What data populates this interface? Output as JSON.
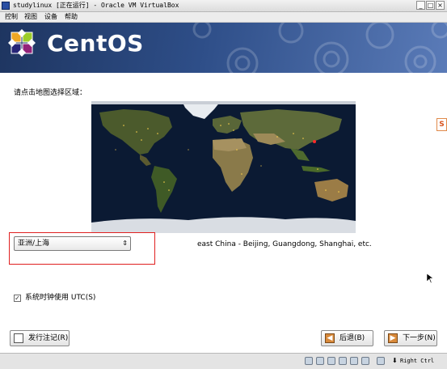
{
  "window": {
    "title": "studylinux [正在运行] - Oracle VM VirtualBox",
    "minimize_glyph": "_",
    "maximize_glyph": "□",
    "close_glyph": "×"
  },
  "menubar": {
    "items": [
      "控制",
      "视图",
      "设备",
      "帮助"
    ]
  },
  "banner": {
    "wordmark": "CentOS",
    "logo_icon": "centos-logo-icon"
  },
  "timezone": {
    "instruction": "请点击地图选择区域：",
    "selected_zone": "亚洲/上海",
    "dropdown_arrow": "⇕",
    "description": "east China - Beijing, Guangdong, Shanghai, etc."
  },
  "utc": {
    "checked": true,
    "label": "系统时钟使用 UTC(S)",
    "check_glyph": "✓"
  },
  "buttons": {
    "release_notes": "发行注记(R)",
    "back": "后退(B)",
    "next": "下一步(N)",
    "back_glyph": "◀",
    "next_glyph": "▶"
  },
  "side_tab": {
    "glyph": "S"
  },
  "statusbar": {
    "host_key": "Right Ctrl",
    "host_key_arrow": "⬇"
  },
  "colors": {
    "banner_dark": "#1e3560",
    "banner_light": "#5a7bb8",
    "highlight_border": "#e02020",
    "map_ocean": "#0b1a33"
  }
}
